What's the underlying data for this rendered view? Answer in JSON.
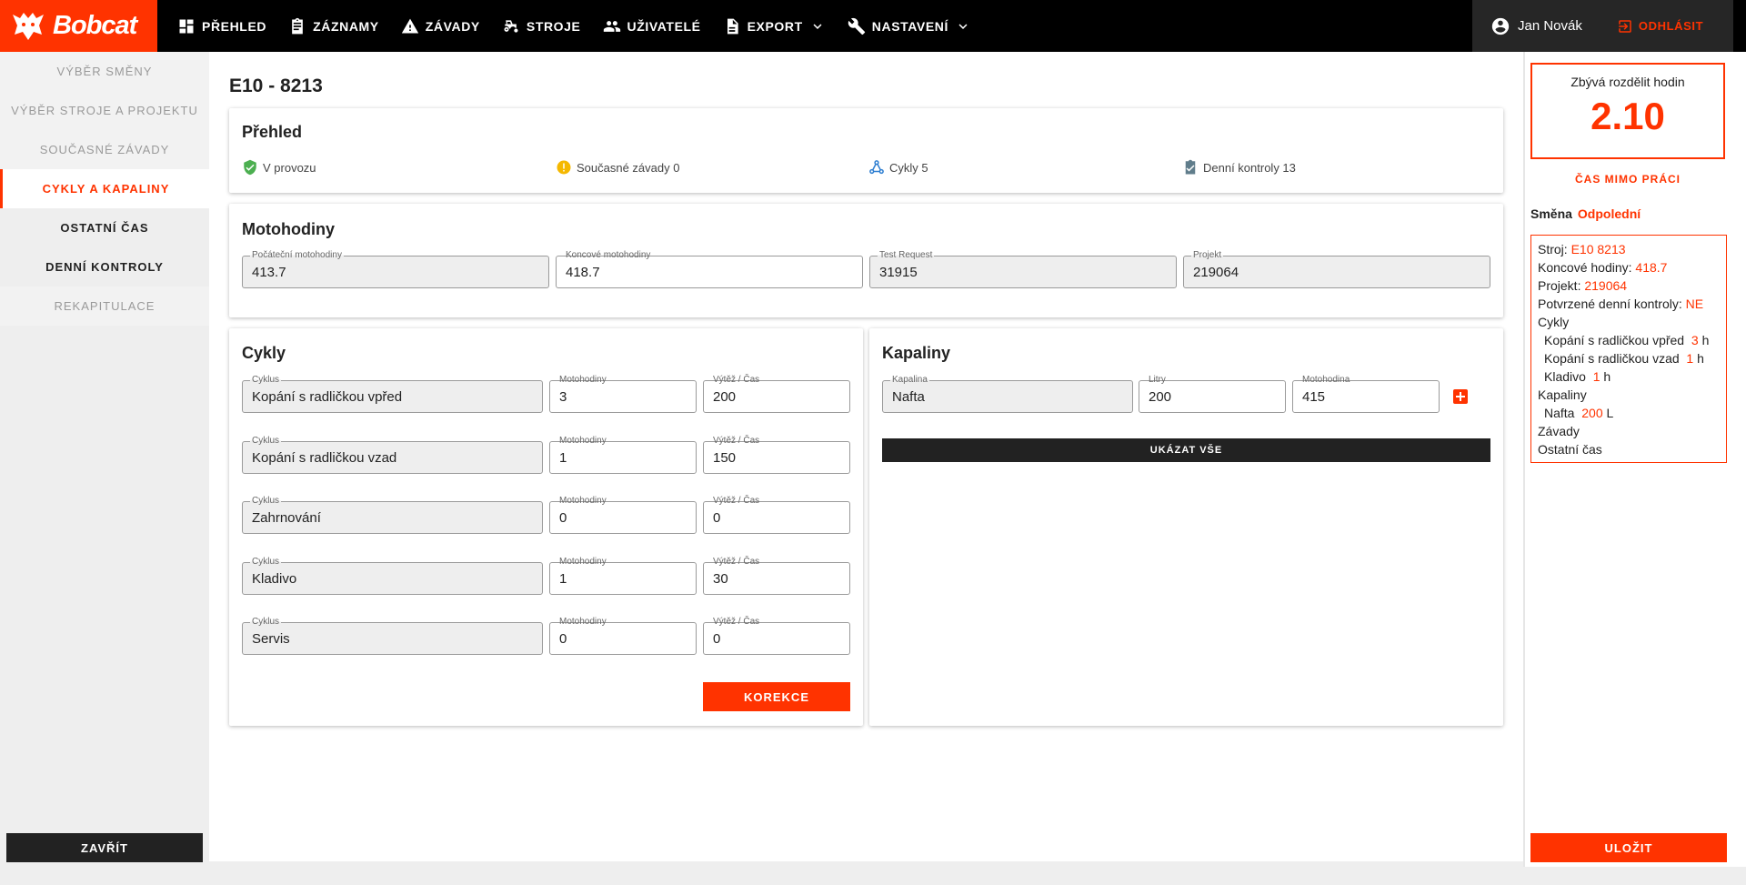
{
  "brand": {
    "name": "Bobcat"
  },
  "nav": {
    "items": [
      {
        "label": "PŘEHLED",
        "icon": "dashboard-icon"
      },
      {
        "label": "ZÁZNAMY",
        "icon": "clipboard-icon"
      },
      {
        "label": "ZÁVADY",
        "icon": "warning-icon"
      },
      {
        "label": "STROJE",
        "icon": "tractor-icon"
      },
      {
        "label": "UŽIVATELÉ",
        "icon": "users-icon"
      },
      {
        "label": "EXPORT",
        "icon": "file-icon"
      },
      {
        "label": "NASTAVENÍ",
        "icon": "wrench-icon"
      }
    ],
    "user_name": "Jan Novák",
    "logout_label": "ODHLÁSIT"
  },
  "sidebar": {
    "items": [
      {
        "label": "VÝBĚR SMĚNY"
      },
      {
        "label": "VÝBĚR STROJE A PROJEKTU"
      },
      {
        "label": "SOUČASNÉ ZÁVADY"
      },
      {
        "label": "CYKLY A KAPALINY"
      },
      {
        "label": "OSTATNÍ ČAS"
      },
      {
        "label": "DENNÍ KONTROLY"
      },
      {
        "label": "REKAPITULACE"
      }
    ],
    "close_label": "ZAVŘÍT"
  },
  "main": {
    "title": "E10 - 8213",
    "overview": {
      "title": "Přehled",
      "status": "V provozu",
      "faults": "Současné závady 0",
      "cycles": "Cykly 5",
      "daily_checks": "Denní kontroly 13"
    },
    "motohours": {
      "title": "Motohodiny",
      "start_label": "Počáteční motohodiny",
      "start_value": "413.7",
      "end_label": "Koncové motohodiny",
      "end_value": "418.7",
      "request_label": "Test Request",
      "request_value": "31915",
      "project_label": "Projekt",
      "project_value": "219064"
    },
    "cycles": {
      "title": "Cykly",
      "cycle_label": "Cyklus",
      "hours_label": "Motohodiny",
      "yield_label": "Výtěž / Čas",
      "rows": [
        {
          "name": "Kopání s radličkou vpřed",
          "hours": "3",
          "yield": "200"
        },
        {
          "name": "Kopání s radličkou vzad",
          "hours": "1",
          "yield": "150"
        },
        {
          "name": "Zahrnování",
          "hours": "0",
          "yield": "0"
        },
        {
          "name": "Kladivo",
          "hours": "1",
          "yield": "30"
        },
        {
          "name": "Servis",
          "hours": "0",
          "yield": "0"
        }
      ],
      "correction_label": "KOREKCE"
    },
    "fluids": {
      "title": "Kapaliny",
      "fluid_label": "Kapalina",
      "fluid_value": "Nafta",
      "liters_label": "Litry",
      "liters_value": "200",
      "motohour_label": "Motohodina",
      "motohour_value": "415",
      "show_all_label": "UKÁZAT VŠE"
    }
  },
  "right": {
    "hours_label": "Zbývá rozdělit hodin",
    "hours_value": "2.10",
    "time_off_label": "ČAS MIMO PRÁCI",
    "shift_label": "Směna",
    "shift_value": "Odpolední",
    "summary": {
      "machine_label": "Stroj:",
      "machine_value": "E10 8213",
      "end_hours_label": "Koncové hodiny:",
      "end_hours_value": "418.7",
      "project_label": "Projekt:",
      "project_value": "219064",
      "checks_label": "Potvrzené denní kontroly:",
      "checks_value": "NE",
      "cycles_label": "Cykly",
      "cycle_rows": [
        {
          "name": "Kopání s radličkou vpřed",
          "value": "3",
          "unit": "h"
        },
        {
          "name": "Kopání s radličkou vzad",
          "value": "1",
          "unit": "h"
        },
        {
          "name": "Kladivo",
          "value": "1",
          "unit": "h"
        }
      ],
      "fluids_label": "Kapaliny",
      "fluid_rows": [
        {
          "name": "Nafta",
          "value": "200",
          "unit": "L"
        }
      ],
      "faults_label": "Závady",
      "other_time_label": "Ostatní čas"
    },
    "save_label": "ULOŽIT"
  },
  "colors": {
    "accent": "#ff3300",
    "dark": "#222222",
    "nav_bg": "#000000"
  }
}
